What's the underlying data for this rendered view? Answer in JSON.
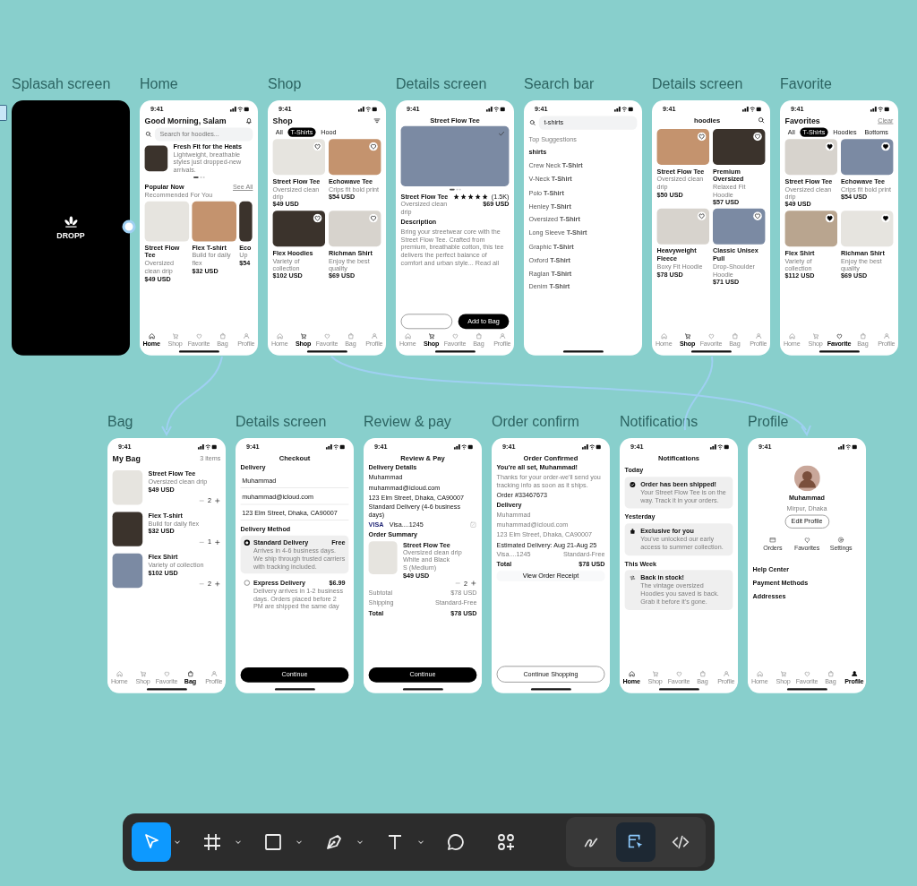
{
  "canvas": {
    "upper_frames": [
      {
        "label": "Splasah screen",
        "kind": "splash",
        "logo": "DROPP"
      },
      {
        "label": "Home",
        "kind": "home",
        "time": "9:41",
        "greeting": "Good Morning, Salam",
        "search_placeholder": "Search for hoodies...",
        "banner": {
          "title": "Fresh Fit for the Heats",
          "text": "Lightweight, breathable styles just dropped-new arrivals."
        },
        "section": {
          "title": "Popular Now",
          "link": "See All",
          "subtitle": "Recommended For You"
        },
        "products": [
          {
            "name": "Street Flow Tee",
            "subtitle": "Oversized clean drip",
            "price": "$49 USD"
          },
          {
            "name": "Flex T-shirt",
            "subtitle": "Build for daily flex",
            "price": "$32 USD"
          },
          {
            "name": "Eco",
            "subtitle": "Up",
            "price": "$54"
          }
        ],
        "tab_bar": [
          {
            "label": "Home",
            "selected": true
          },
          {
            "label": "Shop",
            "selected": false
          },
          {
            "label": "Favorite",
            "selected": false
          },
          {
            "label": "Bag",
            "selected": false
          },
          {
            "label": "Profile",
            "selected": false
          }
        ]
      },
      {
        "label": "Shop",
        "kind": "shop",
        "time": "9:41",
        "title": "Shop",
        "chips": [
          {
            "label": "All",
            "selected": false
          },
          {
            "label": "T-Shirts",
            "selected": true
          },
          {
            "label": "Hood",
            "selected": false
          }
        ],
        "products": [
          {
            "name": "Street Flow Tee",
            "subtitle": "Oversized clean drip",
            "price": "$49 USD",
            "favorited": false
          },
          {
            "name": "Echowave Tee",
            "subtitle": "Crips fit bold print",
            "price": "$54 USD",
            "favorited": false
          },
          {
            "name": "Flex Hoodies",
            "subtitle": "Variety of collection",
            "price": "$102 USD",
            "favorited": false
          },
          {
            "name": "Richman Shirt",
            "subtitle": "Enjoy the best quality",
            "price": "$69 USD",
            "favorited": false
          }
        ],
        "tab_bar": [
          {
            "label": "Home",
            "selected": false
          },
          {
            "label": "Shop",
            "selected": true
          },
          {
            "label": "Favorite",
            "selected": false
          },
          {
            "label": "Bag",
            "selected": false
          },
          {
            "label": "Profile",
            "selected": false
          }
        ]
      },
      {
        "label": "Details screen",
        "kind": "details",
        "time": "9:41",
        "title": "Street Flow Tee",
        "name": "Street Flow Tee",
        "subtitle": "Oversized clean drip",
        "stars": 5,
        "rating": "(1.5K)",
        "price": "$69 USD",
        "description_title": "Description",
        "description": "Bring your streetwear core with the Street Flow Tee. Crafted from premium, breathable cotton, this tee delivers the perfect balance of comfort and urban style... Read all",
        "primary_button": "Add to Bag",
        "tab_bar": [
          {
            "label": "Home",
            "selected": false
          },
          {
            "label": "Shop",
            "selected": true
          },
          {
            "label": "Favorite",
            "selected": false
          },
          {
            "label": "Bag",
            "selected": false
          },
          {
            "label": "Profile",
            "selected": false
          }
        ]
      },
      {
        "label": "Search bar",
        "kind": "search",
        "time": "9:41",
        "query": "t-shirts",
        "heading": "Top Suggestions",
        "first": "shirts",
        "suggestions": [
          "Crew Neck **T-Shirt**",
          "V-Neck **T-Shirt**",
          "Polo **T-Shirt**",
          "Henley **T-Shirt**",
          "Oversized **T-Shirt**",
          "Long Sleeve **T-Shirt**",
          "Graphic **T-Shirt**",
          "Oxford **T-Shirt**",
          "Raglan **T-Shirt**",
          "Denim **T-Shirt**"
        ]
      },
      {
        "label": "Details screen",
        "kind": "results",
        "time": "9:41",
        "title": "hoodies",
        "products": [
          {
            "name": "Street Flow Tee",
            "subtitle": "Oversized clean drip",
            "price": "$50 USD",
            "favorited": false
          },
          {
            "name": "Premium Oversized",
            "subtitle": "Relaxed Fit Hoodie",
            "price": "$57 USD",
            "favorited": false
          },
          {
            "name": "Heavyweight Fleece",
            "subtitle": "Boxy Fit Hoodie",
            "price": "$78 USD",
            "favorited": false
          },
          {
            "name": "Classic Unisex Pull",
            "subtitle": "Drop-Shoulder Hoodie",
            "price": "$71 USD",
            "favorited": false
          }
        ],
        "tab_bar": [
          {
            "label": "Home",
            "selected": false
          },
          {
            "label": "Shop",
            "selected": true
          },
          {
            "label": "Favorite",
            "selected": false
          },
          {
            "label": "Bag",
            "selected": false
          },
          {
            "label": "Profile",
            "selected": false
          }
        ]
      },
      {
        "label": "Favorite",
        "kind": "favorites",
        "time": "9:41",
        "title": "Favorites",
        "action": "Clear",
        "chips": [
          {
            "label": "All",
            "selected": false
          },
          {
            "label": "T-Shirts",
            "selected": true
          },
          {
            "label": "Hoodies",
            "selected": false
          },
          {
            "label": "Bottoms",
            "selected": false
          }
        ],
        "products": [
          {
            "name": "Street Flow Tee",
            "subtitle": "Oversized clean drip",
            "price": "$49 USD",
            "favorited": true
          },
          {
            "name": "Echowave Tee",
            "subtitle": "Crips fit bold print",
            "price": "$54 USD",
            "favorited": true
          },
          {
            "name": "Flex Shirt",
            "subtitle": "Variety of collection",
            "price": "$112 USD",
            "favorited": true
          },
          {
            "name": "Richman Shirt",
            "subtitle": "Enjoy the best quality",
            "price": "$69 USD",
            "favorited": true
          }
        ],
        "tab_bar": [
          {
            "label": "Home",
            "selected": false
          },
          {
            "label": "Shop",
            "selected": false
          },
          {
            "label": "Favorite",
            "selected": true
          },
          {
            "label": "Bag",
            "selected": false
          },
          {
            "label": "Profile",
            "selected": false
          }
        ]
      }
    ],
    "lower_frames": [
      {
        "label": "Bag",
        "kind": "bag",
        "time": "9:41",
        "title": "My Bag",
        "count": "3 items",
        "items": [
          {
            "name": "Street Flow Tee",
            "subtitle": "Oversized clean drip",
            "price": "$49 USD",
            "qty": "2"
          },
          {
            "name": "Flex T-shirt",
            "subtitle": "Build for daily flex",
            "price": "$32 USD",
            "qty": "1"
          },
          {
            "name": "Flex Shirt",
            "subtitle": "Variety of collection",
            "price": "$102 USD",
            "qty": "2"
          }
        ],
        "tab_bar": [
          {
            "label": "Home",
            "selected": false
          },
          {
            "label": "Shop",
            "selected": false
          },
          {
            "label": "Favorite",
            "selected": false
          },
          {
            "label": "Bag",
            "selected": true
          },
          {
            "label": "Profile",
            "selected": false
          }
        ]
      },
      {
        "label": "Details screen",
        "kind": "checkout",
        "time": "9:41",
        "title": "Checkout",
        "delivery_title": "Delivery",
        "fields": [
          "Muhammad",
          "muhammad@icloud.com",
          "123 Elm Street, Dhaka, CA90007"
        ],
        "method_title": "Delivery Method",
        "options": [
          {
            "name": "Standard Delivery",
            "price": "Free",
            "text": "Arrives in 4-6 business days. We ship through trusted carriers with tracking included.",
            "selected": true
          },
          {
            "name": "Express Delivery",
            "price": "$6.99",
            "text": "Delivery arrives in 1-2 business days. Orders placed before 2 PM are shipped the same day",
            "selected": false
          }
        ],
        "button": "Continue"
      },
      {
        "label": "Review & pay",
        "kind": "review",
        "time": "9:41",
        "title": "Review & Pay",
        "details_title": "Delivery Details",
        "lines": [
          "Muhammad",
          "muhammad@icloud.com",
          "123 Elm Street, Dhaka, CA90007",
          "Standard Delivery (4-6 business days)"
        ],
        "card_brand": "VISA",
        "card": "Visa....1245",
        "summary_title": "Order Summary",
        "item": {
          "name": "Street Flow Tee",
          "details": [
            "Oversized clean drip",
            "White and Black",
            "S (Medium)"
          ],
          "price": "$49 USD",
          "qty": "2"
        },
        "totals": [
          {
            "label": "Subtotal",
            "value": "$78 USD",
            "strong": false
          },
          {
            "label": "Shipping",
            "value": "Standard-Free",
            "strong": false
          },
          {
            "label": "Total",
            "value": "$78 USD",
            "strong": true
          }
        ],
        "button": "Continue"
      },
      {
        "label": "Order confirm",
        "kind": "confirm",
        "time": "9:41",
        "title": "Order Confirmed",
        "heading": "You're all set, Muhammad!",
        "text": "Thanks for your order-we'll send you tracking info as soon as it ships.",
        "order": "Order #33467673",
        "delivery_title": "Delivery",
        "lines": [
          "Muhammad",
          "muhammad@icloud.com",
          "123 Elm Street, Dhaka, CA90007"
        ],
        "estimate": "Estimated Delivery: Aug 21-Aug 25",
        "summary": [
          {
            "label": "Visa....1245",
            "value": "Standard-Free",
            "strong": false
          },
          {
            "label": "Total",
            "value": "$78 USD",
            "strong": true
          }
        ],
        "receipt_button": "View Order Receipt",
        "button": "Continue Shopping"
      },
      {
        "label": "Notifications",
        "kind": "notifications",
        "time": "9:41",
        "title": "Notifications",
        "groups": [
          {
            "heading": "Today",
            "items": [
              {
                "kind": "shipped",
                "title": "Order has been shipped!",
                "text": "Your Street Flow Tee is on the way. Track it in your orders."
              }
            ]
          },
          {
            "heading": "Yesterday",
            "items": [
              {
                "kind": "offer",
                "title": "Exclusive for you",
                "text": "You've unlocked our early access to summer collection."
              }
            ]
          },
          {
            "heading": "This Week",
            "items": [
              {
                "kind": "restock",
                "title": "Back in stock!",
                "text": "The vintage oversized Hoodies you saved is back. Grab it before it's gone."
              }
            ]
          }
        ],
        "tab_bar": [
          {
            "label": "Home",
            "selected": true
          },
          {
            "label": "Shop",
            "selected": false
          },
          {
            "label": "Favorite",
            "selected": false
          },
          {
            "label": "Bag",
            "selected": false
          },
          {
            "label": "Profile",
            "selected": false
          }
        ]
      },
      {
        "label": "Profile",
        "kind": "profile",
        "time": "9:41",
        "name": "Muhammad",
        "location": "Mirpur, Dhaka",
        "edit_button": "Edit Profile",
        "shortcuts": [
          {
            "kind": "orders",
            "label": "Orders"
          },
          {
            "kind": "favorites",
            "label": "Favorites"
          },
          {
            "kind": "settings",
            "label": "Settings"
          }
        ],
        "menu": [
          "Help Center",
          "Payment Methods",
          "Addresses"
        ],
        "tab_bar": [
          {
            "label": "Home",
            "selected": false
          },
          {
            "label": "Shop",
            "selected": false
          },
          {
            "label": "Favorite",
            "selected": false
          },
          {
            "label": "Bag",
            "selected": false
          },
          {
            "label": "Profile",
            "selected": true
          }
        ]
      }
    ]
  },
  "toolbar": {
    "tools": [
      {
        "kind": "move",
        "selected": true,
        "menu": true
      },
      {
        "kind": "frame",
        "selected": false,
        "menu": true
      },
      {
        "kind": "rectangle",
        "selected": false,
        "menu": true
      },
      {
        "kind": "pen",
        "selected": false,
        "menu": true
      },
      {
        "kind": "text",
        "selected": false,
        "menu": true
      },
      {
        "kind": "comment",
        "selected": false,
        "menu": false
      },
      {
        "kind": "actions",
        "selected": false,
        "menu": false
      }
    ],
    "modes": [
      {
        "kind": "draw",
        "selected": false
      },
      {
        "kind": "design",
        "selected": true
      },
      {
        "kind": "dev",
        "selected": false
      }
    ]
  }
}
